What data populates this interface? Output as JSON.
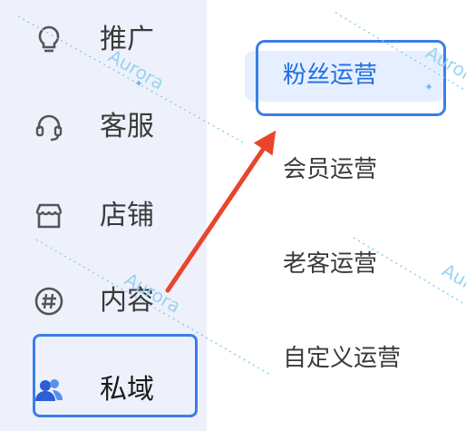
{
  "sidebar": {
    "items": [
      {
        "label": "推广",
        "icon": "lightbulb-icon"
      },
      {
        "label": "客服",
        "icon": "headset-icon"
      },
      {
        "label": "店铺",
        "icon": "store-icon"
      },
      {
        "label": "内容",
        "icon": "hashtag-icon"
      },
      {
        "label": "私域",
        "icon": "users-icon",
        "active": true
      }
    ]
  },
  "submenu": {
    "items": [
      {
        "label": "粉丝运营",
        "active": true
      },
      {
        "label": "会员运营"
      },
      {
        "label": "老客运营"
      },
      {
        "label": "自定义运营"
      }
    ]
  },
  "watermark": "Aurora",
  "colors": {
    "accent": "#3b7ee8",
    "active_text": "#1f6fe6",
    "arrow": "#e8452c",
    "sidebar_bg": "#eef1fb",
    "watermark": "#8fd0ef"
  }
}
